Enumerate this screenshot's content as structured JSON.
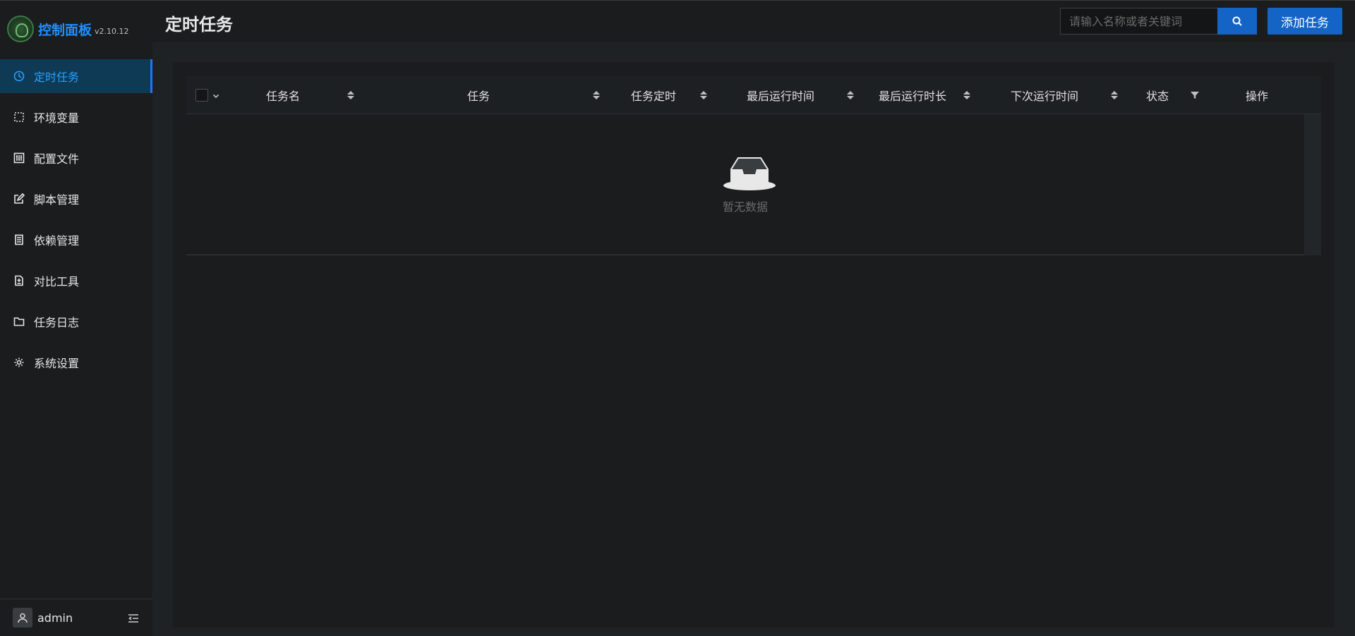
{
  "app": {
    "title": "控制面板",
    "version": "v2.10.12"
  },
  "sidebar": {
    "items": [
      {
        "label": "定时任务",
        "icon": "clock-icon",
        "active": true
      },
      {
        "label": "环境变量",
        "icon": "dashed-box-icon",
        "active": false
      },
      {
        "label": "配置文件",
        "icon": "sliders-icon",
        "active": false
      },
      {
        "label": "脚本管理",
        "icon": "edit-icon",
        "active": false
      },
      {
        "label": "依赖管理",
        "icon": "book-icon",
        "active": false
      },
      {
        "label": "对比工具",
        "icon": "diff-icon",
        "active": false
      },
      {
        "label": "任务日志",
        "icon": "folder-icon",
        "active": false
      },
      {
        "label": "系统设置",
        "icon": "gear-icon",
        "active": false
      }
    ],
    "user": {
      "name": "admin"
    }
  },
  "header": {
    "title": "定时任务",
    "search_placeholder": "请输入名称或者关键词",
    "add_label": "添加任务"
  },
  "table": {
    "columns": [
      "任务名",
      "任务",
      "任务定时",
      "最后运行时间",
      "最后运行时长",
      "下次运行时间",
      "状态",
      "操作"
    ],
    "empty_text": "暂无数据"
  },
  "colors": {
    "accent": "#1464c6",
    "active_menu_bg": "#0e3a55",
    "active_menu_text": "#2ba0ff",
    "logo_text": "#1e90ff"
  }
}
